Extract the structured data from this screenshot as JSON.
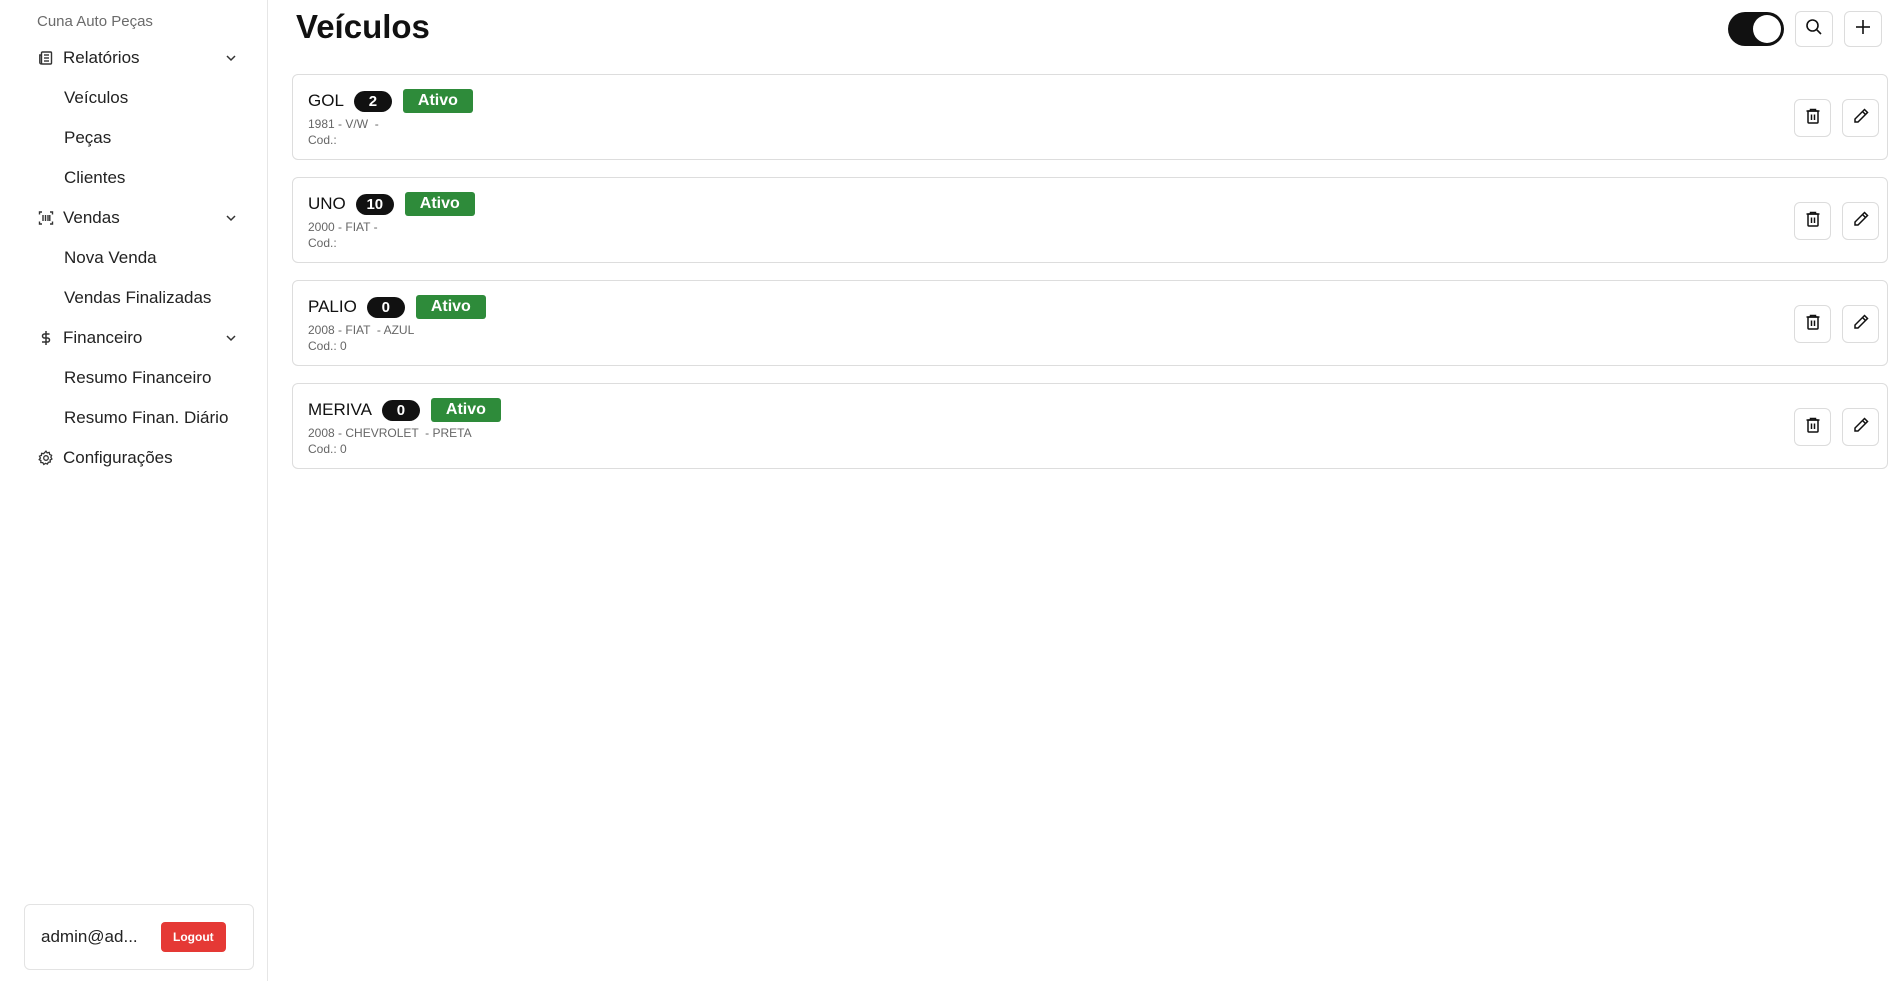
{
  "sidebar": {
    "brand": "Cuna Auto Peças",
    "groups": [
      {
        "label": "Relatórios",
        "icon": "newspaper-icon",
        "items": [
          "Veículos",
          "Peças",
          "Clientes"
        ]
      },
      {
        "label": "Vendas",
        "icon": "barcode-scan-icon",
        "items": [
          "Nova Venda",
          "Vendas Finalizadas"
        ]
      },
      {
        "label": "Financeiro",
        "icon": "dollar-icon",
        "items": [
          "Resumo Financeiro",
          "Resumo Finan. Diário"
        ]
      }
    ],
    "settings_label": "Configurações",
    "user": {
      "email": "admin@ad...",
      "logout_label": "Logout"
    }
  },
  "main": {
    "title": "Veículos",
    "toolbar": {
      "toggle_on": true,
      "search_icon": "search-icon",
      "add_icon": "plus-icon"
    },
    "vehicles": [
      {
        "name": "GOL",
        "qty": "2",
        "status": "Ativo",
        "sub": "1981 - V/W  -",
        "cod": "Cod.:"
      },
      {
        "name": "UNO",
        "qty": "10",
        "status": "Ativo",
        "sub": "2000 - FIAT -",
        "cod": "Cod.:"
      },
      {
        "name": "PALIO",
        "qty": "0",
        "status": "Ativo",
        "sub": "2008 - FIAT  - AZUL",
        "cod": "Cod.: 0"
      },
      {
        "name": "MERIVA",
        "qty": "0",
        "status": "Ativo",
        "sub": "2008 - CHEVROLET  - PRETA",
        "cod": "Cod.: 0"
      }
    ]
  },
  "colors": {
    "status_active": "#2e8b3a",
    "logout": "#e53935",
    "badge": "#111111"
  }
}
